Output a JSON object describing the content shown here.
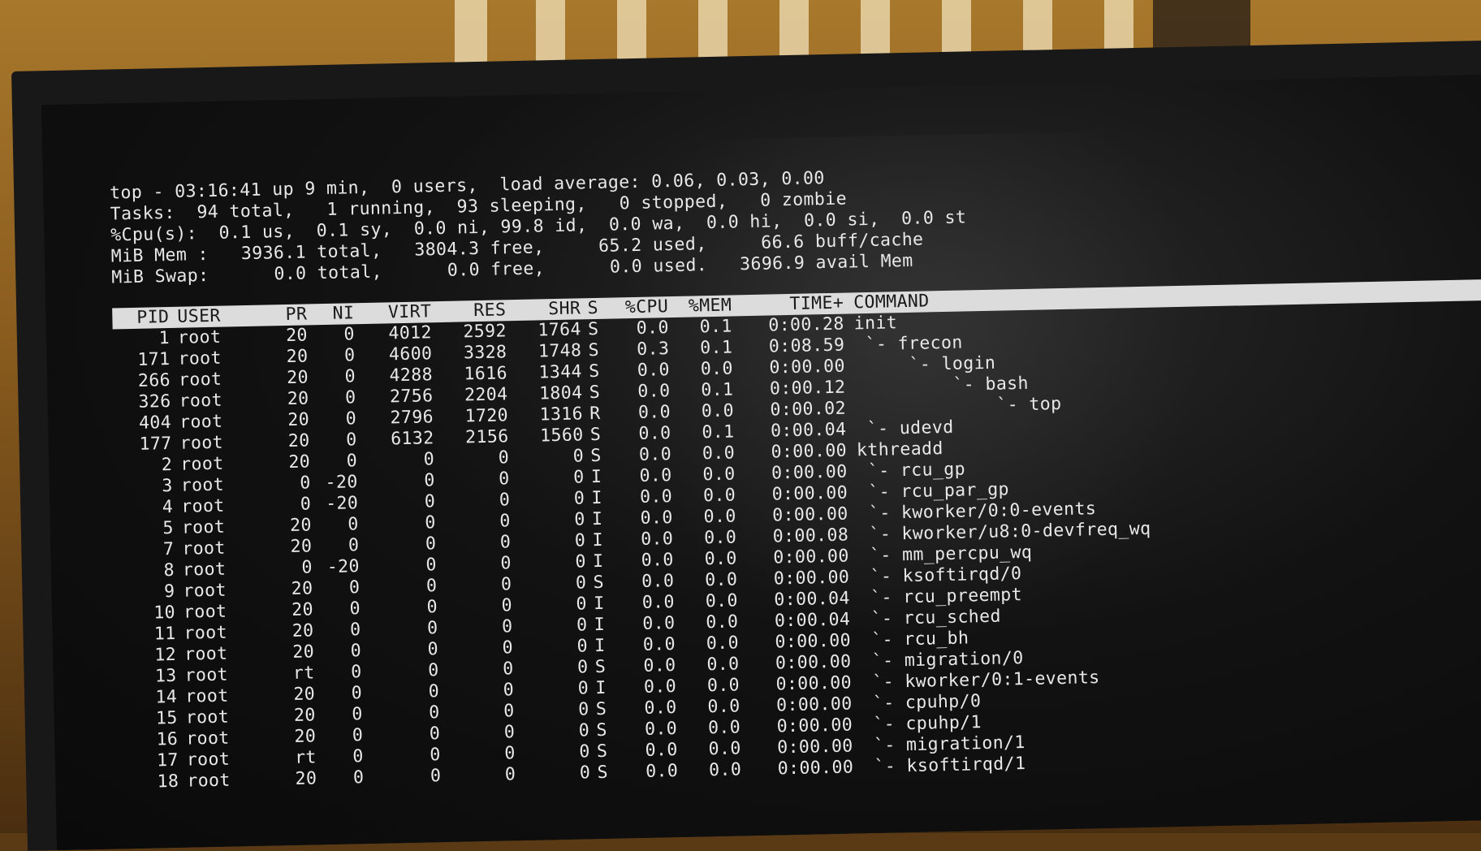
{
  "summary": {
    "line1": "top - 03:16:41 up 9 min,  0 users,  load average: 0.06, 0.03, 0.00",
    "line2": "Tasks:  94 total,   1 running,  93 sleeping,   0 stopped,   0 zombie",
    "line3": "%Cpu(s):  0.1 us,  0.1 sy,  0.0 ni, 99.8 id,  0.0 wa,  0.0 hi,  0.0 si,  0.0 st",
    "line4": "MiB Mem :   3936.1 total,   3804.3 free,     65.2 used,     66.6 buff/cache",
    "line5": "MiB Swap:      0.0 total,      0.0 free,      0.0 used.   3696.9 avail Mem"
  },
  "columns": {
    "pid": "PID",
    "user": "USER",
    "pr": "PR",
    "ni": "NI",
    "virt": "VIRT",
    "res": "RES",
    "shr": "SHR",
    "s": "S",
    "cpu": "%CPU",
    "mem": "%MEM",
    "time": "TIME+",
    "command": "COMMAND"
  },
  "processes": [
    {
      "pid": "1",
      "user": "root",
      "pr": "20",
      "ni": "0",
      "virt": "4012",
      "res": "2592",
      "shr": "1764",
      "s": "S",
      "cpu": "0.0",
      "mem": "0.1",
      "time": "0:00.28",
      "command": "init"
    },
    {
      "pid": "171",
      "user": "root",
      "pr": "20",
      "ni": "0",
      "virt": "4600",
      "res": "3328",
      "shr": "1748",
      "s": "S",
      "cpu": "0.3",
      "mem": "0.1",
      "time": "0:08.59",
      "command": " `- frecon"
    },
    {
      "pid": "266",
      "user": "root",
      "pr": "20",
      "ni": "0",
      "virt": "4288",
      "res": "1616",
      "shr": "1344",
      "s": "S",
      "cpu": "0.0",
      "mem": "0.0",
      "time": "0:00.00",
      "command": "     `- login"
    },
    {
      "pid": "326",
      "user": "root",
      "pr": "20",
      "ni": "0",
      "virt": "2756",
      "res": "2204",
      "shr": "1804",
      "s": "S",
      "cpu": "0.0",
      "mem": "0.1",
      "time": "0:00.12",
      "command": "         `- bash"
    },
    {
      "pid": "404",
      "user": "root",
      "pr": "20",
      "ni": "0",
      "virt": "2796",
      "res": "1720",
      "shr": "1316",
      "s": "R",
      "cpu": "0.0",
      "mem": "0.0",
      "time": "0:00.02",
      "command": "             `- top"
    },
    {
      "pid": "177",
      "user": "root",
      "pr": "20",
      "ni": "0",
      "virt": "6132",
      "res": "2156",
      "shr": "1560",
      "s": "S",
      "cpu": "0.0",
      "mem": "0.1",
      "time": "0:00.04",
      "command": " `- udevd"
    },
    {
      "pid": "2",
      "user": "root",
      "pr": "20",
      "ni": "0",
      "virt": "0",
      "res": "0",
      "shr": "0",
      "s": "S",
      "cpu": "0.0",
      "mem": "0.0",
      "time": "0:00.00",
      "command": "kthreadd"
    },
    {
      "pid": "3",
      "user": "root",
      "pr": "0",
      "ni": "-20",
      "virt": "0",
      "res": "0",
      "shr": "0",
      "s": "I",
      "cpu": "0.0",
      "mem": "0.0",
      "time": "0:00.00",
      "command": " `- rcu_gp"
    },
    {
      "pid": "4",
      "user": "root",
      "pr": "0",
      "ni": "-20",
      "virt": "0",
      "res": "0",
      "shr": "0",
      "s": "I",
      "cpu": "0.0",
      "mem": "0.0",
      "time": "0:00.00",
      "command": " `- rcu_par_gp"
    },
    {
      "pid": "5",
      "user": "root",
      "pr": "20",
      "ni": "0",
      "virt": "0",
      "res": "0",
      "shr": "0",
      "s": "I",
      "cpu": "0.0",
      "mem": "0.0",
      "time": "0:00.00",
      "command": " `- kworker/0:0-events"
    },
    {
      "pid": "7",
      "user": "root",
      "pr": "20",
      "ni": "0",
      "virt": "0",
      "res": "0",
      "shr": "0",
      "s": "I",
      "cpu": "0.0",
      "mem": "0.0",
      "time": "0:00.08",
      "command": " `- kworker/u8:0-devfreq_wq"
    },
    {
      "pid": "8",
      "user": "root",
      "pr": "0",
      "ni": "-20",
      "virt": "0",
      "res": "0",
      "shr": "0",
      "s": "I",
      "cpu": "0.0",
      "mem": "0.0",
      "time": "0:00.00",
      "command": " `- mm_percpu_wq"
    },
    {
      "pid": "9",
      "user": "root",
      "pr": "20",
      "ni": "0",
      "virt": "0",
      "res": "0",
      "shr": "0",
      "s": "S",
      "cpu": "0.0",
      "mem": "0.0",
      "time": "0:00.00",
      "command": " `- ksoftirqd/0"
    },
    {
      "pid": "10",
      "user": "root",
      "pr": "20",
      "ni": "0",
      "virt": "0",
      "res": "0",
      "shr": "0",
      "s": "I",
      "cpu": "0.0",
      "mem": "0.0",
      "time": "0:00.04",
      "command": " `- rcu_preempt"
    },
    {
      "pid": "11",
      "user": "root",
      "pr": "20",
      "ni": "0",
      "virt": "0",
      "res": "0",
      "shr": "0",
      "s": "I",
      "cpu": "0.0",
      "mem": "0.0",
      "time": "0:00.04",
      "command": " `- rcu_sched"
    },
    {
      "pid": "12",
      "user": "root",
      "pr": "20",
      "ni": "0",
      "virt": "0",
      "res": "0",
      "shr": "0",
      "s": "I",
      "cpu": "0.0",
      "mem": "0.0",
      "time": "0:00.00",
      "command": " `- rcu_bh"
    },
    {
      "pid": "13",
      "user": "root",
      "pr": "rt",
      "ni": "0",
      "virt": "0",
      "res": "0",
      "shr": "0",
      "s": "S",
      "cpu": "0.0",
      "mem": "0.0",
      "time": "0:00.00",
      "command": " `- migration/0"
    },
    {
      "pid": "14",
      "user": "root",
      "pr": "20",
      "ni": "0",
      "virt": "0",
      "res": "0",
      "shr": "0",
      "s": "I",
      "cpu": "0.0",
      "mem": "0.0",
      "time": "0:00.00",
      "command": " `- kworker/0:1-events"
    },
    {
      "pid": "15",
      "user": "root",
      "pr": "20",
      "ni": "0",
      "virt": "0",
      "res": "0",
      "shr": "0",
      "s": "S",
      "cpu": "0.0",
      "mem": "0.0",
      "time": "0:00.00",
      "command": " `- cpuhp/0"
    },
    {
      "pid": "16",
      "user": "root",
      "pr": "20",
      "ni": "0",
      "virt": "0",
      "res": "0",
      "shr": "0",
      "s": "S",
      "cpu": "0.0",
      "mem": "0.0",
      "time": "0:00.00",
      "command": " `- cpuhp/1"
    },
    {
      "pid": "17",
      "user": "root",
      "pr": "rt",
      "ni": "0",
      "virt": "0",
      "res": "0",
      "shr": "0",
      "s": "S",
      "cpu": "0.0",
      "mem": "0.0",
      "time": "0:00.00",
      "command": " `- migration/1"
    },
    {
      "pid": "18",
      "user": "root",
      "pr": "20",
      "ni": "0",
      "virt": "0",
      "res": "0",
      "shr": "0",
      "s": "S",
      "cpu": "0.0",
      "mem": "0.0",
      "time": "0:00.00",
      "command": " `- ksoftirqd/1"
    }
  ]
}
